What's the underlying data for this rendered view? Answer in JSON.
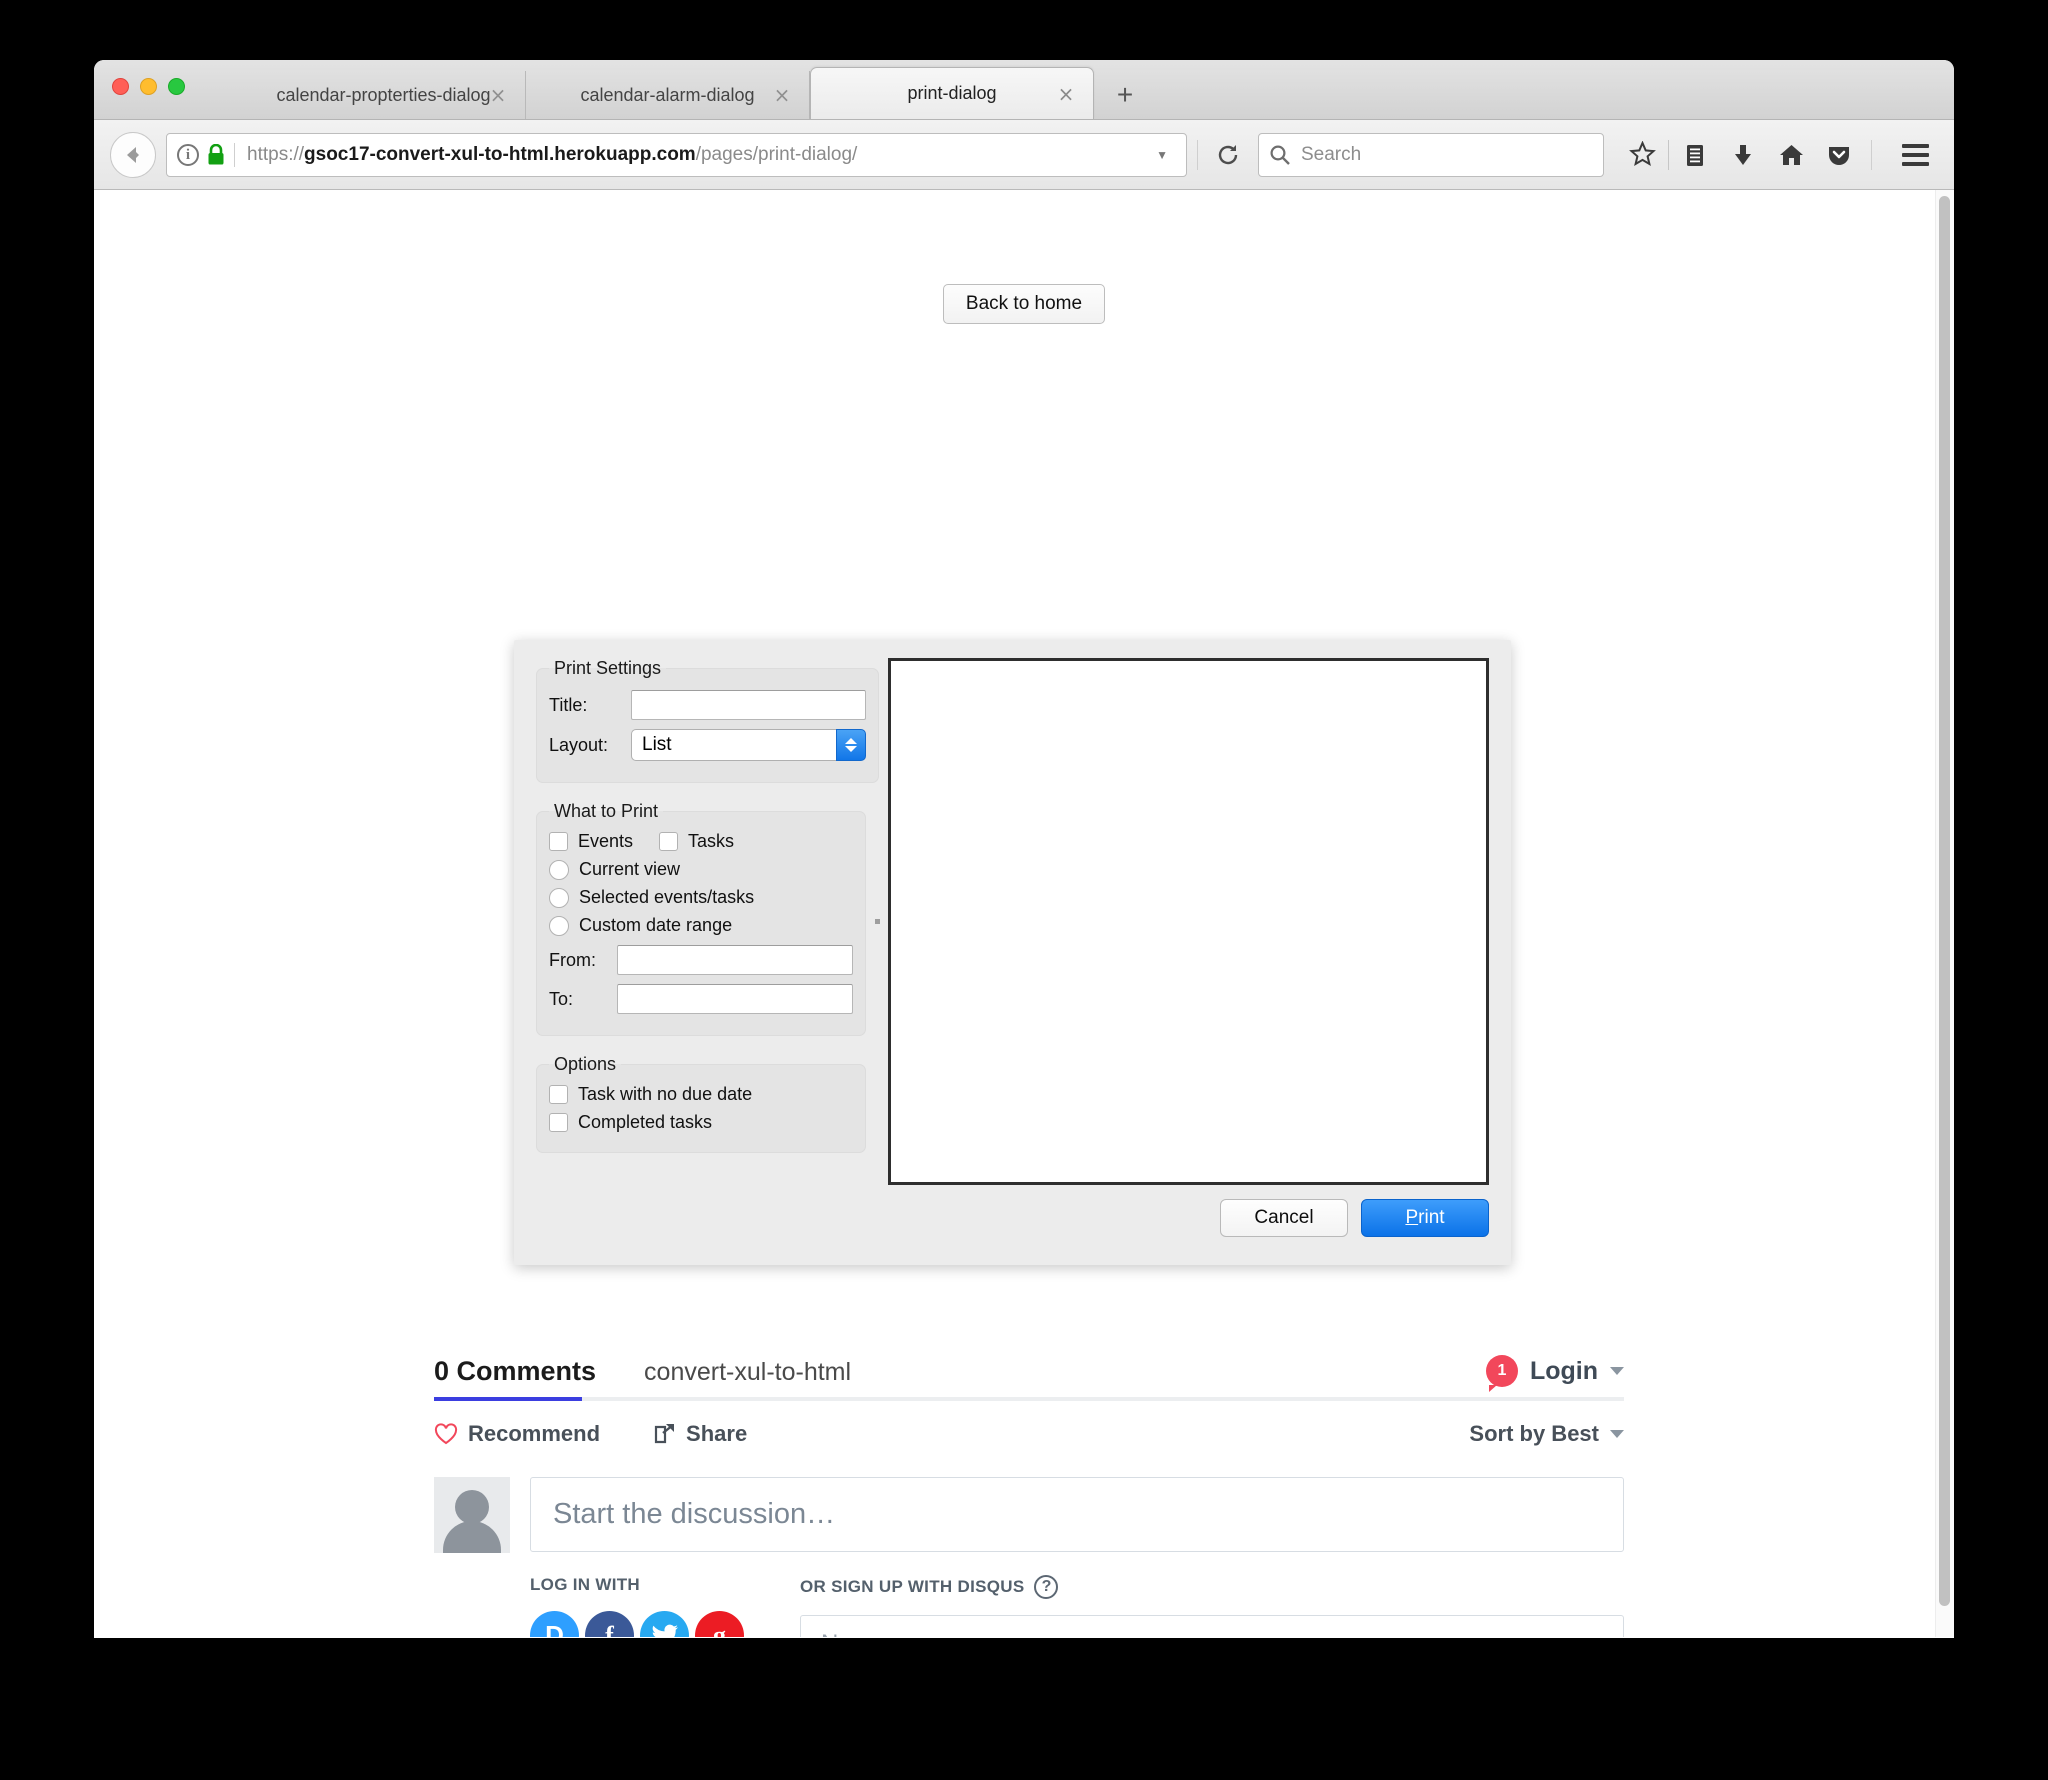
{
  "browser": {
    "tabs": [
      {
        "label": "calendar-propterties-dialog",
        "active": false,
        "close": "×"
      },
      {
        "label": "calendar-alarm-dialog",
        "active": false,
        "close": "×"
      },
      {
        "label": "print-dialog",
        "active": true,
        "close": "×"
      }
    ],
    "new_tab_label": "+",
    "url": {
      "scheme": "https://",
      "host": "gsoc17-convert-xul-to-html.herokuapp.com",
      "path": "/pages/print-dialog/"
    },
    "search_placeholder": "Search",
    "toolbar_icons": [
      "back-icon",
      "info-icon",
      "lock-icon",
      "dropdown-marker-icon",
      "reload-icon",
      "search-icon",
      "bookmark-star-icon",
      "library-icon",
      "downloads-icon",
      "home-icon",
      "pocket-icon",
      "menu-hamburger-icon"
    ]
  },
  "page": {
    "back_to_home_label": "Back to home"
  },
  "print_dialog": {
    "sections": {
      "print_settings": {
        "legend": "Print Settings",
        "title_label": "Title:",
        "title_value": "",
        "layout_label": "Layout:",
        "layout_value": "List"
      },
      "what_to_print": {
        "legend": "What to Print",
        "checkboxes": [
          {
            "label": "Events",
            "checked": false
          },
          {
            "label": "Tasks",
            "checked": false
          }
        ],
        "radios": [
          {
            "label": "Current view",
            "checked": false
          },
          {
            "label": "Selected events/tasks",
            "checked": false
          },
          {
            "label": "Custom date range",
            "checked": false
          }
        ],
        "from_label": "From:",
        "from_value": "",
        "to_label": "To:",
        "to_value": ""
      },
      "options": {
        "legend": "Options",
        "checkboxes": [
          {
            "label": "Task with no due date",
            "checked": false
          },
          {
            "label": "Completed tasks",
            "checked": false
          }
        ]
      }
    },
    "buttons": {
      "cancel": "Cancel",
      "print_prefix": "P",
      "print_rest": "rint"
    },
    "accent_color": "#0b72e8"
  },
  "disqus": {
    "comments_count": "0 Comments",
    "site_name": "convert-xul-to-html",
    "login_badge": "1",
    "login_label": "Login",
    "recommend_label": "Recommend",
    "share_label": "Share",
    "sort_label": "Sort by Best",
    "compose_placeholder": "Start the discussion…",
    "log_in_with_label": "LOG IN WITH",
    "sign_up_label": "OR SIGN UP WITH DISQUS",
    "name_placeholder": "Name",
    "socials": [
      {
        "name": "disqus",
        "glyph": "D",
        "color": "#2e9fff"
      },
      {
        "name": "facebook",
        "glyph": "f",
        "color": "#3b5998"
      },
      {
        "name": "twitter",
        "glyph": "🐦",
        "color": "#28a9f1"
      },
      {
        "name": "google",
        "glyph": "g",
        "color": "#ec1c24"
      }
    ],
    "accent_color": "#3b3ee0",
    "badge_color": "#f2475b"
  }
}
